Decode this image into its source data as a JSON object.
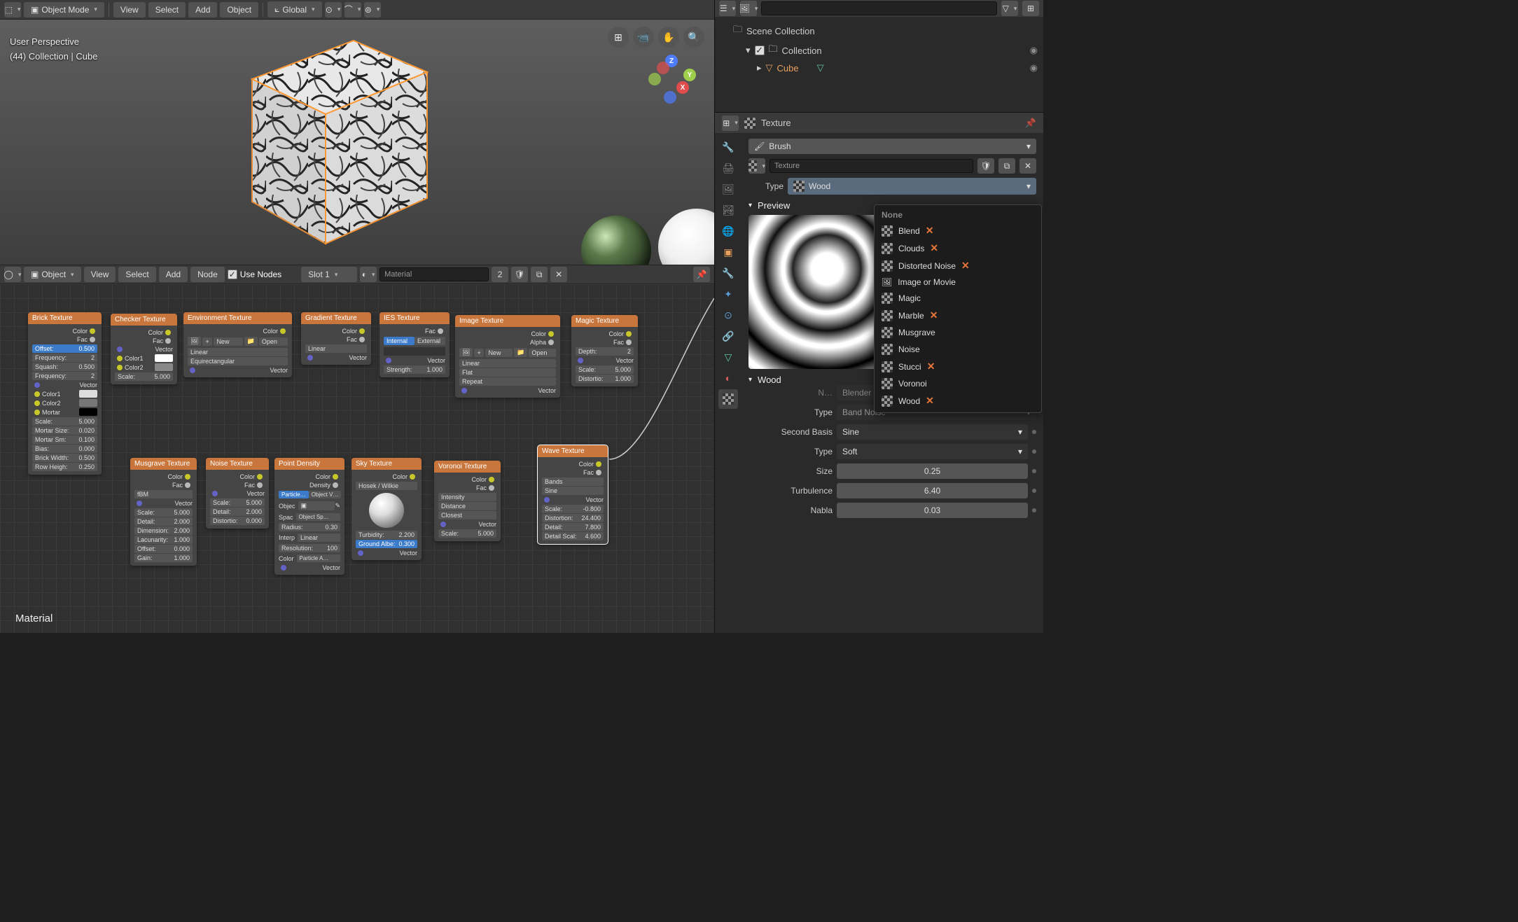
{
  "topbar": {
    "mode_label": "Object Mode",
    "view": "View",
    "select": "Select",
    "add": "Add",
    "object": "Object",
    "orientation": "Global"
  },
  "viewport": {
    "perspective": "User Perspective",
    "context": "(44) Collection | Cube"
  },
  "nodebar": {
    "mode": "Object",
    "view": "View",
    "select": "Select",
    "add": "Add",
    "node": "Node",
    "use_nodes": "Use Nodes",
    "slot": "Slot 1",
    "material": "Material",
    "user_count": "2"
  },
  "outliner": {
    "search_placeholder": "",
    "scene": "Scene Collection",
    "collection": "Collection",
    "cube": "Cube"
  },
  "props": {
    "header": "Texture",
    "brush": "Brush",
    "texture": "Texture",
    "type_label": "Type",
    "type_value": "Wood",
    "preview_label": "Preview",
    "section_label": "Wood",
    "noise_basis_label": "Noise Basis",
    "noise_basis_value": "Blender Original",
    "noise_type_label": "Type",
    "noise_type_value": "Band Noise",
    "second_basis_label": "Second Basis",
    "second_basis_value": "Sine",
    "basis_type_label": "Type",
    "basis_type_value": "Soft",
    "size_label": "Size",
    "size_value": "0.25",
    "turbulence_label": "Turbulence",
    "turbulence_value": "6.40",
    "nabla_label": "Nabla",
    "nabla_value": "0.03"
  },
  "type_menu": {
    "none": "None",
    "blend": "Blend",
    "clouds": "Clouds",
    "distorted": "Distorted Noise",
    "image": "Image or Movie",
    "magic": "Magic",
    "marble": "Marble",
    "musgrave": "Musgrave",
    "noise": "Noise",
    "stucci": "Stucci",
    "voronoi": "Voronoi",
    "wood": "Wood"
  },
  "material_footer": "Material",
  "nodes": {
    "brick": {
      "title": "Brick Texture",
      "color": "Color",
      "fac": "Fac",
      "offset_l": "Offset:",
      "offset_v": "0.500",
      "freq1_l": "Frequency:",
      "freq1_v": "2",
      "squash_l": "Squash:",
      "squash_v": "0.500",
      "freq2_l": "Frequency:",
      "freq2_v": "2",
      "vector": "Vector",
      "color1": "Color1",
      "color2": "Color2",
      "mortar": "Mortar",
      "scale_l": "Scale:",
      "scale_v": "5.000",
      "msize_l": "Mortar Size:",
      "msize_v": "0.020",
      "msm_l": "Mortar Sm:",
      "msm_v": "0.100",
      "bias_l": "Bias:",
      "bias_v": "0.000",
      "bw_l": "Brick Width:",
      "bw_v": "0.500",
      "rh_l": "Row Heigh:",
      "rh_v": "0.250"
    },
    "checker": {
      "title": "Checker Texture",
      "color": "Color",
      "fac": "Fac",
      "vector": "Vector",
      "color1": "Color1",
      "color2": "Color2",
      "scale_l": "Scale:",
      "scale_v": "5.000"
    },
    "env": {
      "title": "Environment Texture",
      "color": "Color",
      "new": "New",
      "open": "Open",
      "linear": "Linear",
      "equirect": "Equirectangular",
      "vector": "Vector"
    },
    "gradient": {
      "title": "Gradient Texture",
      "color": "Color",
      "fac": "Fac",
      "linear": "Linear",
      "vector": "Vector"
    },
    "ies": {
      "title": "IES Texture",
      "fac": "Fac",
      "internal": "Internal",
      "external": "External",
      "vector": "Vector",
      "str_l": "Strength:",
      "str_v": "1.000"
    },
    "image": {
      "title": "Image Texture",
      "color": "Color",
      "alpha": "Alpha",
      "new": "New",
      "open": "Open",
      "linear": "Linear",
      "flat": "Flat",
      "repeat": "Repeat",
      "vector": "Vector"
    },
    "magic": {
      "title": "Magic Texture",
      "color": "Color",
      "fac": "Fac",
      "depth_l": "Depth:",
      "depth_v": "2",
      "vector": "Vector",
      "scale_l": "Scale:",
      "scale_v": "5.000",
      "dist_l": "Distortio:",
      "dist_v": "1.000"
    },
    "musgrave": {
      "title": "Musgrave Texture",
      "color": "Color",
      "fac": "Fac",
      "type": "fBM",
      "vector": "Vector",
      "scale_l": "Scale:",
      "scale_v": "5.000",
      "det_l": "Detail:",
      "det_v": "2.000",
      "dim_l": "Dimension:",
      "dim_v": "2.000",
      "lac_l": "Lacunarity:",
      "lac_v": "1.000",
      "off_l": "Offset:",
      "off_v": "0.000",
      "gain_l": "Gain:",
      "gain_v": "1.000"
    },
    "noise": {
      "title": "Noise Texture",
      "color": "Color",
      "fac": "Fac",
      "vector": "Vector",
      "scale_l": "Scale:",
      "scale_v": "5.000",
      "det_l": "Detail:",
      "det_v": "2.000",
      "dist_l": "Distortio:",
      "dist_v": "0.000"
    },
    "point": {
      "title": "Point Density",
      "color": "Color",
      "density": "Density",
      "particle": "Particle…",
      "objverts": "Object V…",
      "objec_l": "Objec",
      "space_l": "Spac",
      "space_v": "Object Sp…",
      "radius_l": "Radius:",
      "radius_v": "0.30",
      "interp_l": "Interp",
      "interp_v": "Linear",
      "res_l": "Resolution:",
      "res_v": "100",
      "color_l": "Color",
      "color_v": "Particle A…",
      "vector": "Vector"
    },
    "sky": {
      "title": "Sky Texture",
      "color": "Color",
      "model": "Hosek / Wilkie",
      "turb_l": "Turbidity:",
      "turb_v": "2.200",
      "ground_l": "Ground Albe:",
      "ground_v": "0.300",
      "vector": "Vector"
    },
    "voronoi": {
      "title": "Voronoi Texture",
      "color": "Color",
      "fac": "Fac",
      "intensity": "Intensity",
      "distance": "Distance",
      "closest": "Closest",
      "vector": "Vector",
      "scale_l": "Scale:",
      "scale_v": "5.000"
    },
    "wave": {
      "title": "Wave Texture",
      "color": "Color",
      "fac": "Fac",
      "bands": "Bands",
      "sine": "Sine",
      "vector": "Vector",
      "scale_l": "Scale:",
      "scale_v": "-0.800",
      "dist_l": "Distortion:",
      "dist_v": "24.400",
      "det_l": "Detail:",
      "det_v": "7.800",
      "dsc_l": "Detail Scal:",
      "dsc_v": "4.600"
    }
  }
}
